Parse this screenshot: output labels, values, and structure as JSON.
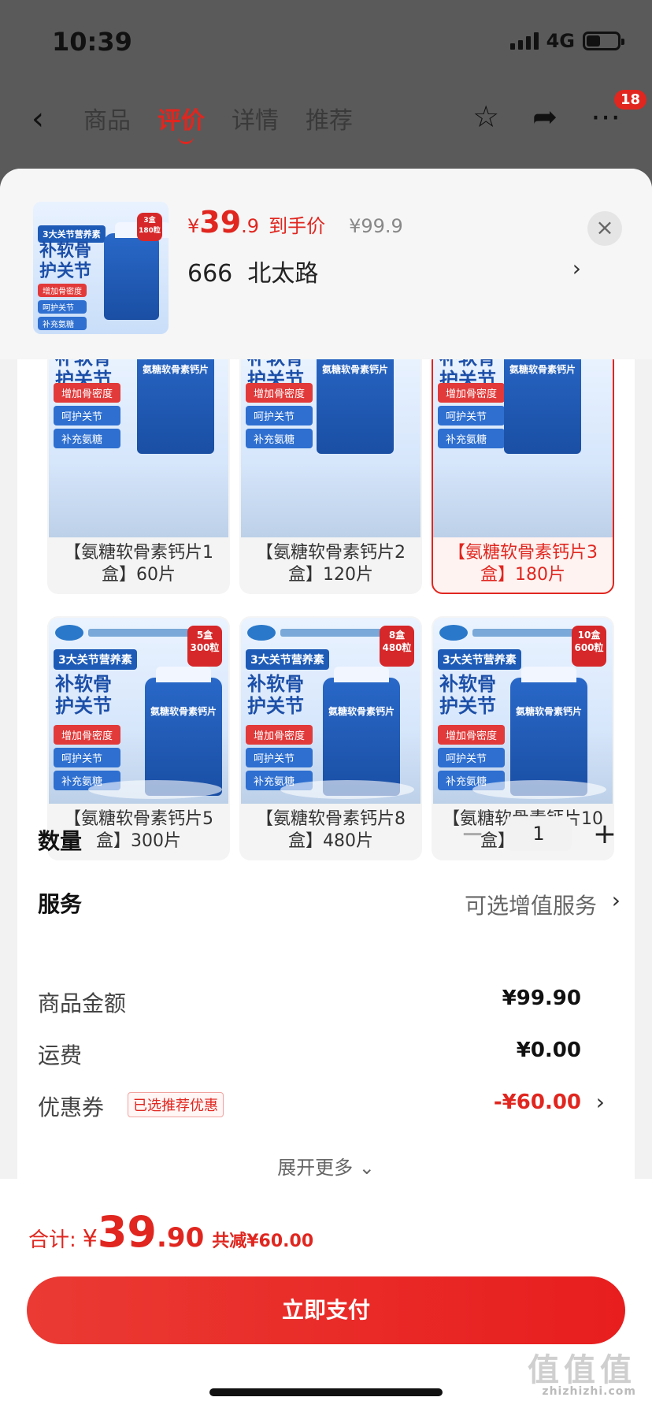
{
  "status": {
    "time": "10:39",
    "network": "4G"
  },
  "nav": {
    "back_icon": "chevron-left-icon",
    "tabs": [
      {
        "label": "商品"
      },
      {
        "label": "评价"
      },
      {
        "label": "详情"
      },
      {
        "label": "推荐"
      }
    ],
    "active_tab": "评价",
    "notification_count": "18"
  },
  "header": {
    "price_yen": "¥",
    "price_int": "39",
    "price_dec": ".9",
    "price_tag": "到手价",
    "original_price": "¥99.9",
    "address": "666  北太路",
    "address_arrow": "›",
    "close": "×",
    "thumb": {
      "nutrient": "3大关节营养素",
      "headline": "补软骨\n护关节",
      "pills": [
        "增加骨密度",
        "呵护关节",
        "补充氨糖"
      ],
      "badge": "3盒\n180粒"
    }
  },
  "options": [
    {
      "name": "【氨糖软骨素钙片1盒】60片",
      "selected": false
    },
    {
      "name": "【氨糖软骨素钙片2盒】120片",
      "selected": false
    },
    {
      "name": "【氨糖软骨素钙片3盒】180片",
      "selected": true
    },
    {
      "name": "【氨糖软骨素钙片5盒】300片",
      "badge": "5盒\n300粒",
      "selected": false
    },
    {
      "name": "【氨糖软骨素钙片8盒】480片",
      "badge": "8盒\n480粒",
      "selected": false
    },
    {
      "name": "【氨糖软骨素钙片10盒】600片",
      "badge": "10盒\n600粒",
      "selected": false
    }
  ],
  "product_art": {
    "nutrient": "3大关节营养素",
    "headline_1": "补软骨",
    "headline_2": "护关节",
    "pills": [
      "增加骨密度",
      "呵护关节",
      "补充氨糖"
    ],
    "bottle_label": "氨糖软骨素钙片",
    "bottle_brand": "ASAU"
  },
  "quantity": {
    "label": "数量",
    "minus": "−",
    "value": "1",
    "plus": "+"
  },
  "service": {
    "label": "服务",
    "value": "可选增值服务",
    "arrow": "›"
  },
  "summary": {
    "goods_label": "商品金额",
    "goods_value": "¥99.90",
    "shipping_label": "运费",
    "shipping_value": "¥0.00",
    "coupon_label": "优惠券",
    "coupon_tag": "已选推荐优惠",
    "coupon_value": "-¥60.00",
    "expand": "展开更多 ⌄"
  },
  "footer": {
    "total_label": "合计:",
    "total_yen": "¥",
    "total_int": "39",
    "total_dec": ".90",
    "total_save": "共减¥60.00",
    "pay_button": "立即支付"
  },
  "watermark": {
    "text": "值值值",
    "sub": "zhizhizhi.com"
  },
  "colors": {
    "accent": "#e0261f",
    "sheet_bg": "#f2f2f2",
    "overlay": "#5a5a5a"
  }
}
